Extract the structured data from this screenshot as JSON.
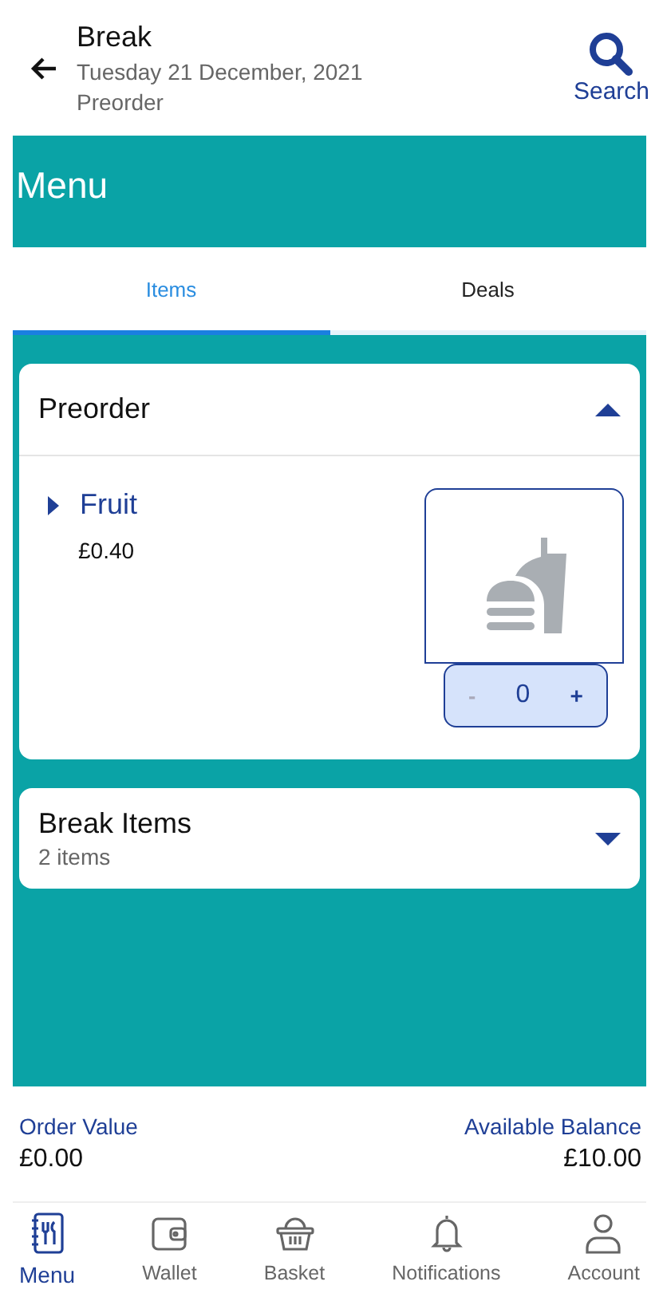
{
  "header": {
    "title": "Break",
    "date": "Tuesday 21 December, 2021",
    "subtitle": "Preorder",
    "search_label": "Search"
  },
  "banner": {
    "title": "Menu"
  },
  "tabs": [
    {
      "label": "Items",
      "selected": true
    },
    {
      "label": "Deals",
      "selected": false
    }
  ],
  "sections": [
    {
      "title": "Preorder",
      "expanded": true,
      "items": [
        {
          "name": "Fruit",
          "price": "£0.40",
          "expanded": false,
          "minus": "-",
          "quantity": "0",
          "plus": "+"
        }
      ]
    },
    {
      "title": "Break Items",
      "count": "2 items",
      "expanded": false
    }
  ],
  "summary": {
    "order_label": "Order Value",
    "order_value": "£0.00",
    "balance_label": "Available Balance",
    "balance_value": "£10.00"
  },
  "nav": [
    {
      "kind": "menu",
      "label": "Menu",
      "selected": true
    },
    {
      "kind": "wallet",
      "label": "Wallet",
      "selected": false
    },
    {
      "kind": "basket",
      "label": "Basket",
      "selected": false
    },
    {
      "kind": "bell",
      "label": "Notifications",
      "selected": false
    },
    {
      "kind": "user",
      "label": "Account",
      "selected": false
    }
  ]
}
